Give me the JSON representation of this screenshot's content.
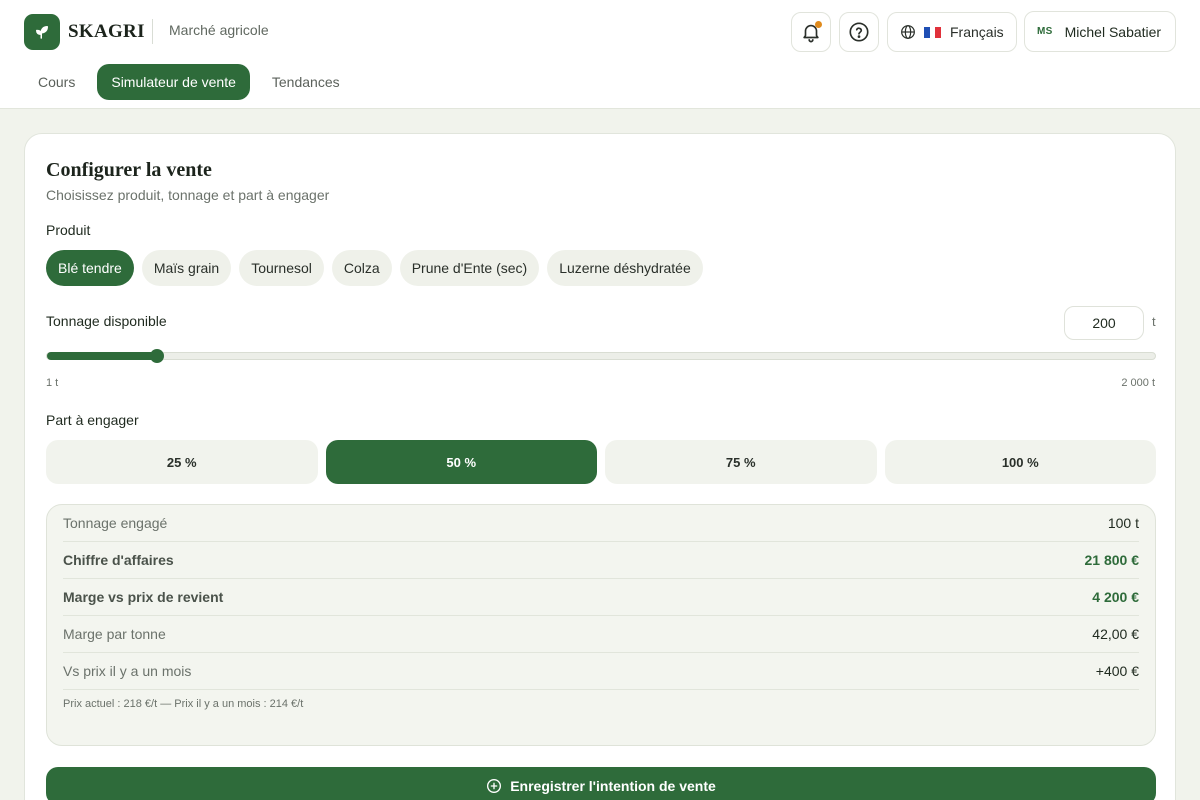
{
  "app": {
    "name": "SKAGRI",
    "subtitle": "Marché agricole"
  },
  "header": {
    "language": "Français",
    "user_initials": "MS",
    "user_name": "Michel Sabatier",
    "has_notification": true,
    "icons": [
      "leaf-icon",
      "bell-icon",
      "help-icon",
      "globe-icon",
      "flag-fr-icon",
      "plus-circle-icon"
    ]
  },
  "tabs": [
    {
      "label": "Cours",
      "active": false
    },
    {
      "label": "Simulateur de vente",
      "active": true
    },
    {
      "label": "Tendances",
      "active": false
    }
  ],
  "card": {
    "title": "Configurer la vente",
    "subtitle": "Choisissez produit, tonnage et part à engager",
    "product_label": "Produit",
    "products": [
      {
        "label": "Blé tendre",
        "active": true
      },
      {
        "label": "Maïs grain",
        "active": false
      },
      {
        "label": "Tournesol",
        "active": false
      },
      {
        "label": "Colza",
        "active": false
      },
      {
        "label": "Prune d'Ente (sec)",
        "active": false
      },
      {
        "label": "Luzerne déshydratée",
        "active": false
      }
    ],
    "tonnage_label": "Tonnage disponible",
    "tonnage_value": "200",
    "tonnage_unit": "t",
    "slider": {
      "min": 1,
      "max": 2000,
      "value": 200,
      "min_label": "1 t",
      "max_label": "2 000 t"
    },
    "part_label": "Part à engager",
    "parts": [
      {
        "label": "25 %",
        "active": false
      },
      {
        "label": "50 %",
        "active": true
      },
      {
        "label": "75 %",
        "active": false
      },
      {
        "label": "100 %",
        "active": false
      }
    ],
    "summary": {
      "rows": [
        {
          "label": "Tonnage engagé",
          "value": "100 t",
          "bold": false
        },
        {
          "label": "Chiffre d'affaires",
          "value": "21 800 €",
          "bold": true
        },
        {
          "label": "Marge vs prix de revient",
          "value": "4 200 €",
          "bold": true
        },
        {
          "label": "Marge par tonne",
          "value": "42,00 €",
          "bold": false
        },
        {
          "label": "Vs prix il y a un mois",
          "value": "+400 €",
          "bold": false
        }
      ],
      "note": "Prix actuel : 218 €/t — Prix il y a un mois : 214 €/t"
    },
    "cta_label": "Enregistrer l'intention de vente"
  },
  "colors": {
    "accent": "#2e6b3a",
    "notification": "#e08a1c",
    "background": "#f1f3ec"
  }
}
